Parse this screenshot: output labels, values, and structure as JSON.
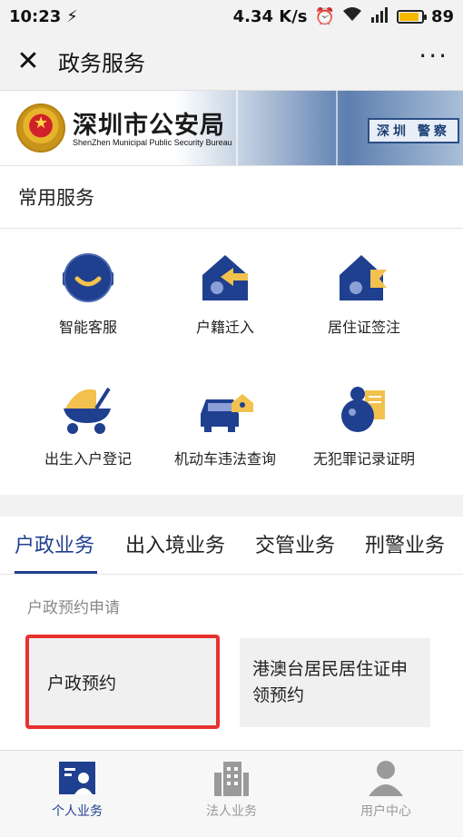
{
  "status_bar": {
    "time": "10:23",
    "speed": "4.34 K/s",
    "battery_level": "89"
  },
  "title_bar": {
    "title": "政务服务",
    "close_icon": "close-icon",
    "more_icon": "more-dots-icon"
  },
  "banner": {
    "org_name": "深圳市公安局",
    "org_name_en": "ShenZhen Municipal Public Security Bureau",
    "sign_text": "深圳 警察"
  },
  "common_services": {
    "heading": "常用服务",
    "items": [
      {
        "label": "智能客服",
        "icon": "customer-service-icon"
      },
      {
        "label": "户籍迁入",
        "icon": "house-arrow-icon"
      },
      {
        "label": "居住证签注",
        "icon": "house-flag-icon"
      },
      {
        "label": "出生入户登记",
        "icon": "baby-stroller-icon"
      },
      {
        "label": "机动车违法查询",
        "icon": "car-icon"
      },
      {
        "label": "无犯罪记录证明",
        "icon": "certificate-icon"
      }
    ]
  },
  "tabs": {
    "items": [
      "户政业务",
      "出入境业务",
      "交管业务",
      "刑警业务"
    ],
    "active_index": 0
  },
  "content": {
    "subheading": "户政预约申请",
    "cards": [
      {
        "label": "户政预约"
      },
      {
        "label": "港澳台居民居住证申领预约"
      }
    ]
  },
  "bottom_nav": {
    "items": [
      {
        "label": "个人业务",
        "icon": "personal-card-icon"
      },
      {
        "label": "法人业务",
        "icon": "building-icon"
      },
      {
        "label": "用户中心",
        "icon": "user-icon"
      }
    ],
    "active_index": 0
  },
  "colors": {
    "brand_blue": "#1f3f8f",
    "accent_yellow": "#f2c14e",
    "highlight_red": "#e8322f"
  }
}
